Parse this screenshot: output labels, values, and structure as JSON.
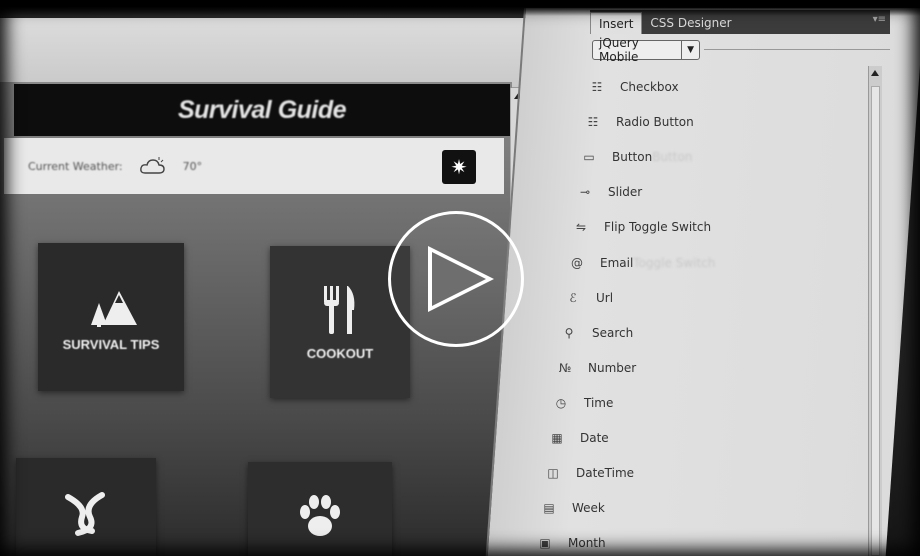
{
  "app": {
    "title": "Survival Guide",
    "weather_label": "Current Weather:",
    "temperature": "70°",
    "weather_icon": "cloud-sun-icon",
    "weather_button_icon": "compass-icon"
  },
  "tiles": [
    {
      "label": "SURVIVAL TIPS",
      "icon": "mountain-tree-icon"
    },
    {
      "label": "COOKOUT",
      "icon": "fork-knife-icon"
    },
    {
      "label": "",
      "icon": "knot-icon"
    },
    {
      "label": "",
      "icon": "paw-icon"
    }
  ],
  "panel": {
    "tabs": [
      {
        "label": "Insert",
        "active": true
      },
      {
        "label": "CSS Designer",
        "active": false
      }
    ],
    "category": "jQuery Mobile",
    "items": [
      {
        "label": "Checkbox",
        "ghost": "",
        "icon": "checkbox-list-icon"
      },
      {
        "label": "Radio Button",
        "ghost": "",
        "icon": "radio-list-icon"
      },
      {
        "label": "Button",
        "ghost": "Button",
        "icon": "button-icon"
      },
      {
        "label": "Slider",
        "ghost": "",
        "icon": "slider-icon"
      },
      {
        "label": "Flip Toggle Switch",
        "ghost": "",
        "icon": "toggle-switch-icon"
      },
      {
        "label": "Email",
        "ghost": "Toggle Switch",
        "icon": "email-icon"
      },
      {
        "label": "Url",
        "ghost": "",
        "icon": "url-icon"
      },
      {
        "label": "Search",
        "ghost": "",
        "icon": "search-icon"
      },
      {
        "label": "Number",
        "ghost": "",
        "icon": "number-icon"
      },
      {
        "label": "Time",
        "ghost": "",
        "icon": "clock-icon"
      },
      {
        "label": "Date",
        "ghost": "",
        "icon": "calendar-icon"
      },
      {
        "label": "DateTime",
        "ghost": "",
        "icon": "datetime-icon"
      },
      {
        "label": "Week",
        "ghost": "",
        "icon": "week-icon"
      },
      {
        "label": "Month",
        "ghost": "",
        "icon": "month-icon"
      }
    ]
  },
  "player": {
    "play_icon": "play-icon"
  },
  "colors": {
    "panel_bg": "#dcdcdc",
    "tile_bg": "#2a2a2a",
    "header_bg": "#0d0d0d"
  }
}
